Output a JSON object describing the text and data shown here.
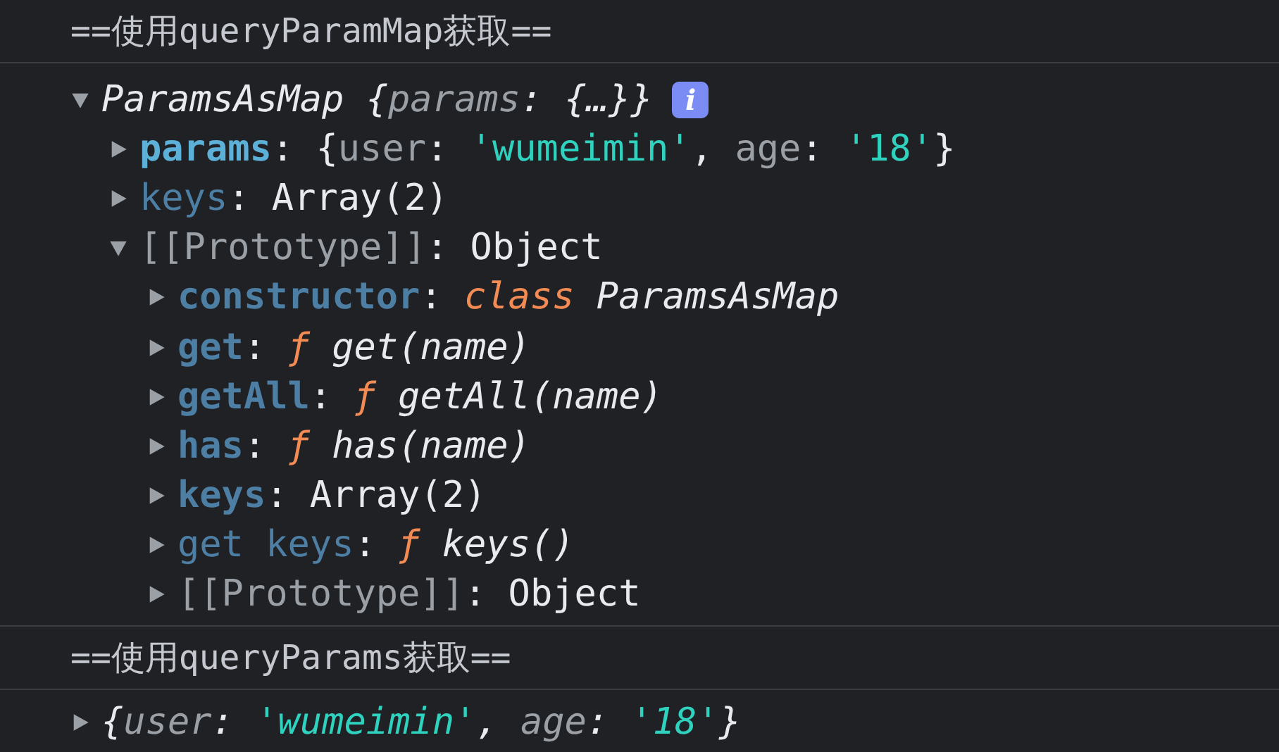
{
  "messages": [
    {
      "kind": "log",
      "text": "==使用queryParamMap获取=="
    },
    {
      "kind": "object",
      "tree": {
        "expanded": true,
        "badge": "i",
        "segments": [
          {
            "text": "ParamsAsMap {",
            "kind": "plain_italic"
          },
          {
            "text": "params",
            "kind": "dim_italic"
          },
          {
            "text": ": {…}}",
            "kind": "plain_italic"
          }
        ],
        "children": [
          {
            "expanded": false,
            "segments": [
              {
                "text": "params",
                "kind": "key_own"
              },
              {
                "text": ": {",
                "kind": "plain"
              },
              {
                "text": "user",
                "kind": "dim"
              },
              {
                "text": ": ",
                "kind": "plain"
              },
              {
                "text": "'wumeimin'",
                "kind": "string"
              },
              {
                "text": ", ",
                "kind": "plain"
              },
              {
                "text": "age",
                "kind": "dim"
              },
              {
                "text": ": ",
                "kind": "plain"
              },
              {
                "text": "'18'",
                "kind": "string"
              },
              {
                "text": "}",
                "kind": "plain"
              }
            ]
          },
          {
            "expanded": false,
            "segments": [
              {
                "text": "keys",
                "kind": "key_dim"
              },
              {
                "text": ": Array(2)",
                "kind": "plain"
              }
            ]
          },
          {
            "expanded": true,
            "segments": [
              {
                "text": "[[Prototype]]",
                "kind": "dim"
              },
              {
                "text": ": Object",
                "kind": "plain"
              }
            ],
            "children": [
              {
                "expanded": false,
                "segments": [
                  {
                    "text": "constructor",
                    "kind": "key"
                  },
                  {
                    "text": ": ",
                    "kind": "plain"
                  },
                  {
                    "text": "class",
                    "kind": "keyword"
                  },
                  {
                    "text": " ParamsAsMap",
                    "kind": "plain_italic"
                  }
                ]
              },
              {
                "expanded": false,
                "segments": [
                  {
                    "text": "get",
                    "kind": "key"
                  },
                  {
                    "text": ": ",
                    "kind": "plain"
                  },
                  {
                    "text": "ƒ",
                    "kind": "keyword"
                  },
                  {
                    "text": " get(name)",
                    "kind": "plain_italic"
                  }
                ]
              },
              {
                "expanded": false,
                "segments": [
                  {
                    "text": "getAll",
                    "kind": "key"
                  },
                  {
                    "text": ": ",
                    "kind": "plain"
                  },
                  {
                    "text": "ƒ",
                    "kind": "keyword"
                  },
                  {
                    "text": " getAll(name)",
                    "kind": "plain_italic"
                  }
                ]
              },
              {
                "expanded": false,
                "segments": [
                  {
                    "text": "has",
                    "kind": "key"
                  },
                  {
                    "text": ": ",
                    "kind": "plain"
                  },
                  {
                    "text": "ƒ",
                    "kind": "keyword"
                  },
                  {
                    "text": " has(name)",
                    "kind": "plain_italic"
                  }
                ]
              },
              {
                "expanded": false,
                "segments": [
                  {
                    "text": "keys",
                    "kind": "key"
                  },
                  {
                    "text": ": Array(2)",
                    "kind": "plain"
                  }
                ]
              },
              {
                "expanded": false,
                "segments": [
                  {
                    "text": "get keys",
                    "kind": "key_dim"
                  },
                  {
                    "text": ": ",
                    "kind": "plain"
                  },
                  {
                    "text": "ƒ",
                    "kind": "keyword"
                  },
                  {
                    "text": " keys()",
                    "kind": "plain_italic"
                  }
                ]
              },
              {
                "expanded": false,
                "segments": [
                  {
                    "text": "[[Prototype]]",
                    "kind": "dim"
                  },
                  {
                    "text": ": Object",
                    "kind": "plain"
                  }
                ]
              }
            ]
          }
        ]
      }
    },
    {
      "kind": "log",
      "text": "==使用queryParams获取=="
    },
    {
      "kind": "object",
      "tree": {
        "expanded": false,
        "segments": [
          {
            "text": "{",
            "kind": "plain_italic"
          },
          {
            "text": "user",
            "kind": "dim_italic"
          },
          {
            "text": ": ",
            "kind": "plain_italic"
          },
          {
            "text": "'wumeimin'",
            "kind": "string_italic"
          },
          {
            "text": ", ",
            "kind": "plain_italic"
          },
          {
            "text": "age",
            "kind": "dim_italic"
          },
          {
            "text": ": ",
            "kind": "plain_italic"
          },
          {
            "text": "'18'",
            "kind": "string_italic"
          },
          {
            "text": "}",
            "kind": "plain_italic"
          }
        ]
      }
    }
  ]
}
